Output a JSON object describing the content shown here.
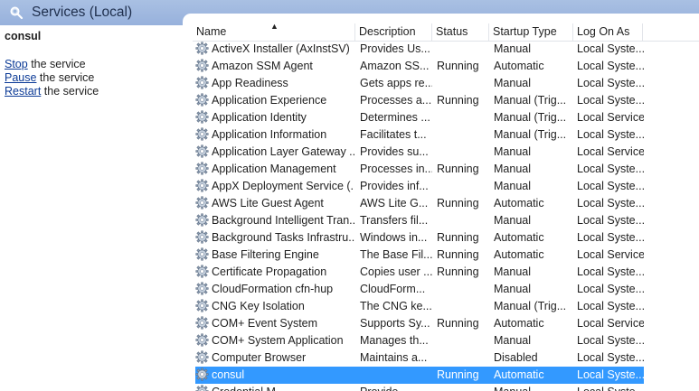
{
  "window": {
    "title": "Services (Local)",
    "title_icon": "services-magnifier-icon"
  },
  "left_pane": {
    "service_name": "consul",
    "actions": [
      {
        "link": "Stop",
        "rest": " the service"
      },
      {
        "link": "Pause",
        "rest": " the service"
      },
      {
        "link": "Restart",
        "rest": " the service"
      }
    ]
  },
  "table": {
    "columns": [
      "Name",
      "Description",
      "Status",
      "Startup Type",
      "Log On As"
    ],
    "sort_column": "Name",
    "selection_color": "#3399ff",
    "rows": [
      {
        "name": "ActiveX Installer (AxInstSV)",
        "description": "Provides Us...",
        "status": "",
        "startup": "Manual",
        "logon": "Local Syste..."
      },
      {
        "name": "Amazon SSM Agent",
        "description": "Amazon SS...",
        "status": "Running",
        "startup": "Automatic",
        "logon": "Local Syste..."
      },
      {
        "name": "App Readiness",
        "description": "Gets apps re...",
        "status": "",
        "startup": "Manual",
        "logon": "Local Syste..."
      },
      {
        "name": "Application Experience",
        "description": "Processes a...",
        "status": "Running",
        "startup": "Manual (Trig...",
        "logon": "Local Syste..."
      },
      {
        "name": "Application Identity",
        "description": "Determines ...",
        "status": "",
        "startup": "Manual (Trig...",
        "logon": "Local Service"
      },
      {
        "name": "Application Information",
        "description": "Facilitates t...",
        "status": "",
        "startup": "Manual (Trig...",
        "logon": "Local Syste..."
      },
      {
        "name": "Application Layer Gateway ...",
        "description": "Provides su...",
        "status": "",
        "startup": "Manual",
        "logon": "Local Service"
      },
      {
        "name": "Application Management",
        "description": "Processes in...",
        "status": "Running",
        "startup": "Manual",
        "logon": "Local Syste..."
      },
      {
        "name": "AppX Deployment Service (...",
        "description": "Provides inf...",
        "status": "",
        "startup": "Manual",
        "logon": "Local Syste..."
      },
      {
        "name": "AWS Lite Guest Agent",
        "description": "AWS Lite G...",
        "status": "Running",
        "startup": "Automatic",
        "logon": "Local Syste..."
      },
      {
        "name": "Background Intelligent Tran...",
        "description": "Transfers fil...",
        "status": "",
        "startup": "Manual",
        "logon": "Local Syste..."
      },
      {
        "name": "Background Tasks Infrastru...",
        "description": "Windows in...",
        "status": "Running",
        "startup": "Automatic",
        "logon": "Local Syste..."
      },
      {
        "name": "Base Filtering Engine",
        "description": "The Base Fil...",
        "status": "Running",
        "startup": "Automatic",
        "logon": "Local Service"
      },
      {
        "name": "Certificate Propagation",
        "description": "Copies user ...",
        "status": "Running",
        "startup": "Manual",
        "logon": "Local Syste..."
      },
      {
        "name": "CloudFormation cfn-hup",
        "description": "CloudForm...",
        "status": "",
        "startup": "Manual",
        "logon": "Local Syste..."
      },
      {
        "name": "CNG Key Isolation",
        "description": "The CNG ke...",
        "status": "",
        "startup": "Manual (Trig...",
        "logon": "Local Syste..."
      },
      {
        "name": "COM+ Event System",
        "description": "Supports Sy...",
        "status": "Running",
        "startup": "Automatic",
        "logon": "Local Service"
      },
      {
        "name": "COM+ System Application",
        "description": "Manages th...",
        "status": "",
        "startup": "Manual",
        "logon": "Local Syste..."
      },
      {
        "name": "Computer Browser",
        "description": "Maintains a...",
        "status": "",
        "startup": "Disabled",
        "logon": "Local Syste..."
      },
      {
        "name": "consul",
        "description": "",
        "status": "Running",
        "startup": "Automatic",
        "logon": "Local Syste...",
        "selected": true
      },
      {
        "name": "Credential M...",
        "description": "Provide...",
        "status": "",
        "startup": "Manual",
        "logon": "Local Syste..."
      }
    ]
  }
}
